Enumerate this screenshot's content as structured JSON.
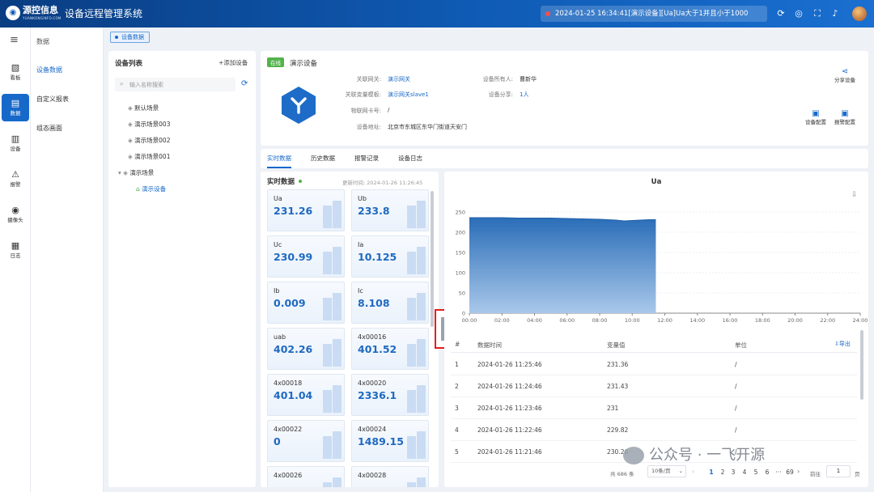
{
  "header": {
    "logo_text": "源控信息",
    "logo_sub": "YUANKONGINFO.COM",
    "title": "设备远程管理系统",
    "alarm": "2024-01-25 16:34:41[演示设备][Ua]Ua大于1并且小于1000"
  },
  "nav": {
    "items": [
      {
        "label": "看板",
        "icon": "dashboard-icon"
      },
      {
        "label": "数据",
        "icon": "data-icon"
      },
      {
        "label": "设备",
        "icon": "device-icon"
      },
      {
        "label": "报警",
        "icon": "alarm-icon"
      },
      {
        "label": "摄像头",
        "icon": "camera-icon"
      },
      {
        "label": "日志",
        "icon": "log-icon"
      }
    ]
  },
  "subnav": {
    "title": "数据",
    "items": [
      "设备数据",
      "自定义报表",
      "组态画面"
    ]
  },
  "breadcrumb": "设备数据",
  "device_list": {
    "title": "设备列表",
    "add": "+添加设备",
    "search_placeholder": "输入名称搜索",
    "tree": [
      "默认场景",
      "演示场景003",
      "演示场景002",
      "演示场景001",
      "演示场景",
      "演示设备"
    ]
  },
  "device": {
    "status": "在线",
    "name": "演示设备",
    "share_label": "分享设备",
    "config_label": "设备配置",
    "alarm_config_label": "报警配置",
    "fields": [
      {
        "k": "关联网关:",
        "v": "演示网关"
      },
      {
        "k": "关联变量模板:",
        "v": "演示网关slave1"
      },
      {
        "k": "物联网卡号:",
        "v": "/"
      },
      {
        "k": "设备地址:",
        "v": "北京市东城区东华门街道天安门"
      }
    ],
    "owner_k": "设备所有人:",
    "owner_v": "曹新华",
    "share_k": "设备分享:",
    "share_v": "1人"
  },
  "tabs": [
    "实时数据",
    "历史数据",
    "报警记录",
    "设备日志"
  ],
  "realtime": {
    "title": "实时数据",
    "update": "更新时间: 2024-01-26 11:26:45",
    "cards": [
      {
        "n": "Ua",
        "v": "231.26"
      },
      {
        "n": "Ub",
        "v": "233.8"
      },
      {
        "n": "Uc",
        "v": "230.99"
      },
      {
        "n": "Ia",
        "v": "10.125"
      },
      {
        "n": "Ib",
        "v": "0.009"
      },
      {
        "n": "Ic",
        "v": "8.108"
      },
      {
        "n": "uab",
        "v": "402.26"
      },
      {
        "n": "4x00016",
        "v": "401.52"
      },
      {
        "n": "4x00018",
        "v": "401.04"
      },
      {
        "n": "4x00020",
        "v": "2336.1"
      },
      {
        "n": "4x00022",
        "v": "0"
      },
      {
        "n": "4x00024",
        "v": "1489.15"
      },
      {
        "n": "4x00026",
        "v": ""
      },
      {
        "n": "4x00028",
        "v": ""
      }
    ]
  },
  "chart_data": {
    "type": "area",
    "title": "Ua",
    "x_ticks": [
      "00:00",
      "02:00",
      "04:00",
      "06:00",
      "08:00",
      "10:00",
      "12:00",
      "14:00",
      "16:00",
      "18:00",
      "20:00",
      "22:00",
      "24:00"
    ],
    "y_ticks": [
      "0",
      "50",
      "100",
      "150",
      "200",
      "250"
    ],
    "ylim": [
      0,
      250
    ],
    "x_hours": [
      0,
      1,
      2,
      3,
      4,
      5,
      6,
      7,
      8,
      9,
      9.5,
      10,
      10.5,
      11,
      11.45
    ],
    "values": [
      236,
      236,
      236,
      235,
      235,
      235,
      234,
      233,
      232,
      230,
      228,
      229,
      230,
      231,
      231
    ]
  },
  "table": {
    "export": "导出",
    "headers": [
      "#",
      "数据时间",
      "变量值",
      "单位"
    ],
    "rows": [
      [
        "1",
        "2024-01-26 11:25:46",
        "231.36",
        "/"
      ],
      [
        "2",
        "2024-01-26 11:24:46",
        "231.43",
        "/"
      ],
      [
        "3",
        "2024-01-26 11:23:46",
        "231",
        "/"
      ],
      [
        "4",
        "2024-01-26 11:22:46",
        "229.82",
        "/"
      ],
      [
        "5",
        "2024-01-26 11:21:46",
        "230.26",
        "/"
      ]
    ]
  },
  "pagination": {
    "total": "共 686 条",
    "size": "10条/页",
    "pages": [
      "1",
      "2",
      "3",
      "4",
      "5",
      "6",
      "···",
      "69"
    ],
    "goto": "前往",
    "page": "1",
    "unit": "页"
  },
  "watermark": "公众号 · 一飞开源"
}
